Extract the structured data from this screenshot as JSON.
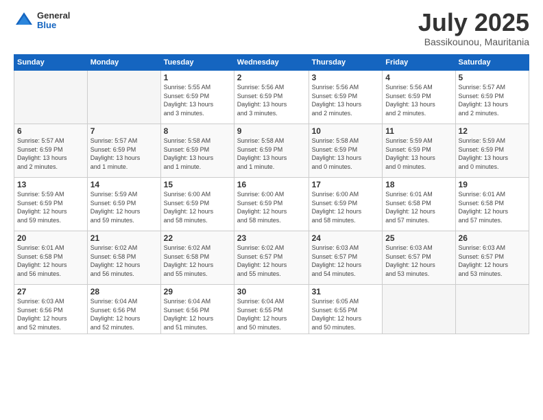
{
  "header": {
    "logo": {
      "general": "General",
      "blue": "Blue"
    },
    "title": "July 2025",
    "location": "Bassikounou, Mauritania"
  },
  "weekdays": [
    "Sunday",
    "Monday",
    "Tuesday",
    "Wednesday",
    "Thursday",
    "Friday",
    "Saturday"
  ],
  "weeks": [
    [
      {
        "day": "",
        "detail": ""
      },
      {
        "day": "",
        "detail": ""
      },
      {
        "day": "1",
        "detail": "Sunrise: 5:55 AM\nSunset: 6:59 PM\nDaylight: 13 hours\nand 3 minutes."
      },
      {
        "day": "2",
        "detail": "Sunrise: 5:56 AM\nSunset: 6:59 PM\nDaylight: 13 hours\nand 3 minutes."
      },
      {
        "day": "3",
        "detail": "Sunrise: 5:56 AM\nSunset: 6:59 PM\nDaylight: 13 hours\nand 2 minutes."
      },
      {
        "day": "4",
        "detail": "Sunrise: 5:56 AM\nSunset: 6:59 PM\nDaylight: 13 hours\nand 2 minutes."
      },
      {
        "day": "5",
        "detail": "Sunrise: 5:57 AM\nSunset: 6:59 PM\nDaylight: 13 hours\nand 2 minutes."
      }
    ],
    [
      {
        "day": "6",
        "detail": "Sunrise: 5:57 AM\nSunset: 6:59 PM\nDaylight: 13 hours\nand 2 minutes."
      },
      {
        "day": "7",
        "detail": "Sunrise: 5:57 AM\nSunset: 6:59 PM\nDaylight: 13 hours\nand 1 minute."
      },
      {
        "day": "8",
        "detail": "Sunrise: 5:58 AM\nSunset: 6:59 PM\nDaylight: 13 hours\nand 1 minute."
      },
      {
        "day": "9",
        "detail": "Sunrise: 5:58 AM\nSunset: 6:59 PM\nDaylight: 13 hours\nand 1 minute."
      },
      {
        "day": "10",
        "detail": "Sunrise: 5:58 AM\nSunset: 6:59 PM\nDaylight: 13 hours\nand 0 minutes."
      },
      {
        "day": "11",
        "detail": "Sunrise: 5:59 AM\nSunset: 6:59 PM\nDaylight: 13 hours\nand 0 minutes."
      },
      {
        "day": "12",
        "detail": "Sunrise: 5:59 AM\nSunset: 6:59 PM\nDaylight: 13 hours\nand 0 minutes."
      }
    ],
    [
      {
        "day": "13",
        "detail": "Sunrise: 5:59 AM\nSunset: 6:59 PM\nDaylight: 12 hours\nand 59 minutes."
      },
      {
        "day": "14",
        "detail": "Sunrise: 5:59 AM\nSunset: 6:59 PM\nDaylight: 12 hours\nand 59 minutes."
      },
      {
        "day": "15",
        "detail": "Sunrise: 6:00 AM\nSunset: 6:59 PM\nDaylight: 12 hours\nand 58 minutes."
      },
      {
        "day": "16",
        "detail": "Sunrise: 6:00 AM\nSunset: 6:59 PM\nDaylight: 12 hours\nand 58 minutes."
      },
      {
        "day": "17",
        "detail": "Sunrise: 6:00 AM\nSunset: 6:59 PM\nDaylight: 12 hours\nand 58 minutes."
      },
      {
        "day": "18",
        "detail": "Sunrise: 6:01 AM\nSunset: 6:58 PM\nDaylight: 12 hours\nand 57 minutes."
      },
      {
        "day": "19",
        "detail": "Sunrise: 6:01 AM\nSunset: 6:58 PM\nDaylight: 12 hours\nand 57 minutes."
      }
    ],
    [
      {
        "day": "20",
        "detail": "Sunrise: 6:01 AM\nSunset: 6:58 PM\nDaylight: 12 hours\nand 56 minutes."
      },
      {
        "day": "21",
        "detail": "Sunrise: 6:02 AM\nSunset: 6:58 PM\nDaylight: 12 hours\nand 56 minutes."
      },
      {
        "day": "22",
        "detail": "Sunrise: 6:02 AM\nSunset: 6:58 PM\nDaylight: 12 hours\nand 55 minutes."
      },
      {
        "day": "23",
        "detail": "Sunrise: 6:02 AM\nSunset: 6:57 PM\nDaylight: 12 hours\nand 55 minutes."
      },
      {
        "day": "24",
        "detail": "Sunrise: 6:03 AM\nSunset: 6:57 PM\nDaylight: 12 hours\nand 54 minutes."
      },
      {
        "day": "25",
        "detail": "Sunrise: 6:03 AM\nSunset: 6:57 PM\nDaylight: 12 hours\nand 53 minutes."
      },
      {
        "day": "26",
        "detail": "Sunrise: 6:03 AM\nSunset: 6:57 PM\nDaylight: 12 hours\nand 53 minutes."
      }
    ],
    [
      {
        "day": "27",
        "detail": "Sunrise: 6:03 AM\nSunset: 6:56 PM\nDaylight: 12 hours\nand 52 minutes."
      },
      {
        "day": "28",
        "detail": "Sunrise: 6:04 AM\nSunset: 6:56 PM\nDaylight: 12 hours\nand 52 minutes."
      },
      {
        "day": "29",
        "detail": "Sunrise: 6:04 AM\nSunset: 6:56 PM\nDaylight: 12 hours\nand 51 minutes."
      },
      {
        "day": "30",
        "detail": "Sunrise: 6:04 AM\nSunset: 6:55 PM\nDaylight: 12 hours\nand 50 minutes."
      },
      {
        "day": "31",
        "detail": "Sunrise: 6:05 AM\nSunset: 6:55 PM\nDaylight: 12 hours\nand 50 minutes."
      },
      {
        "day": "",
        "detail": ""
      },
      {
        "day": "",
        "detail": ""
      }
    ]
  ]
}
